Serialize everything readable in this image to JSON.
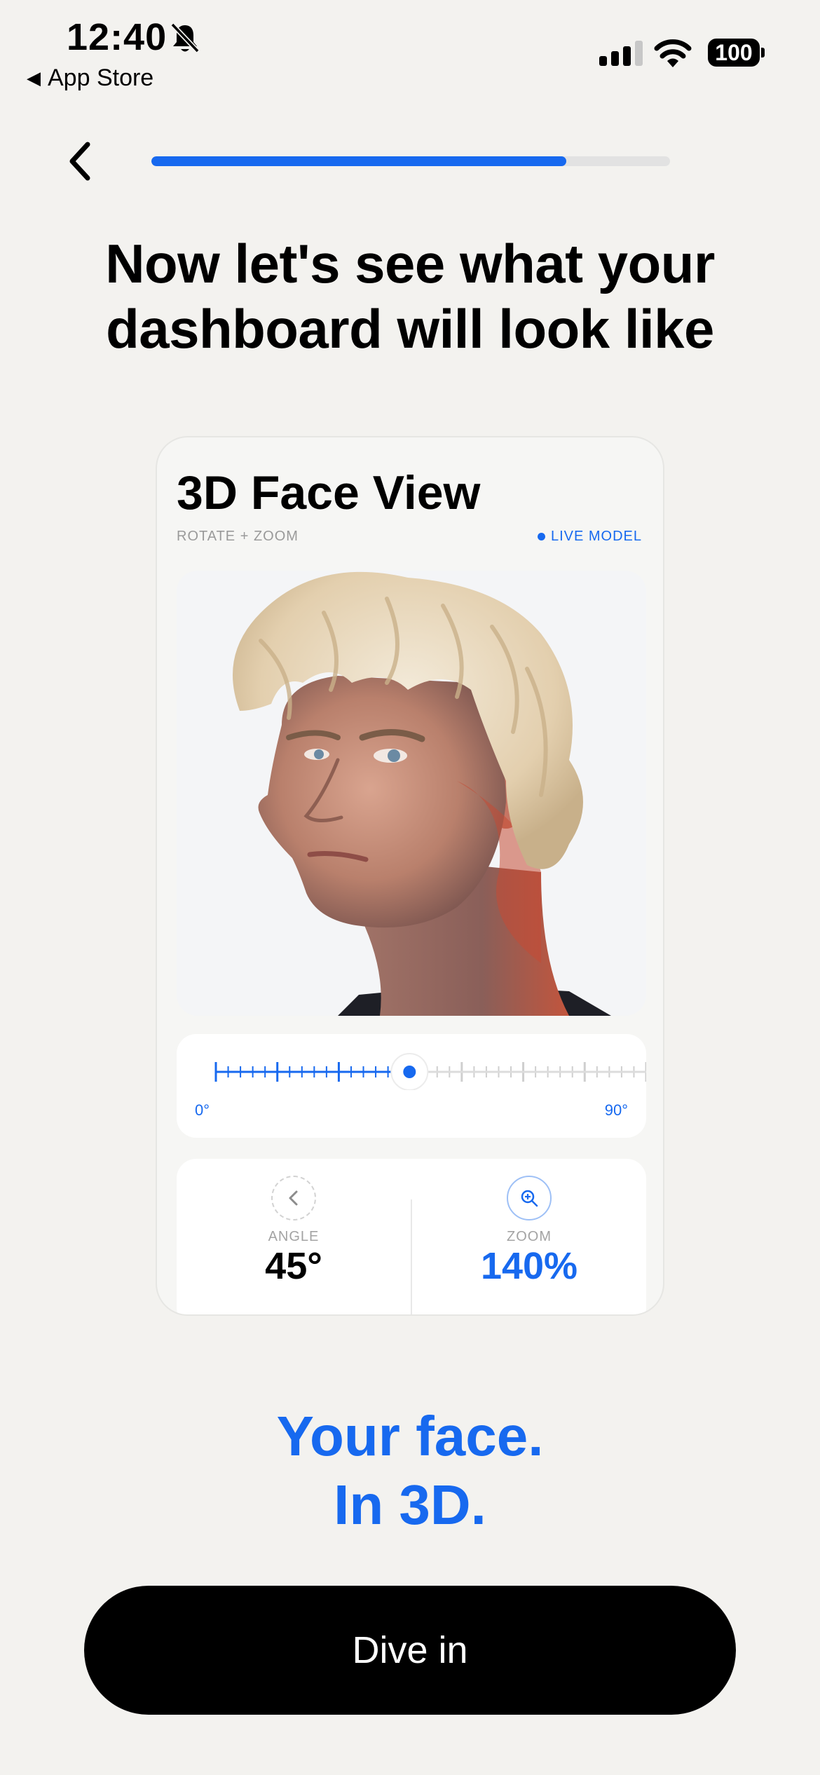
{
  "status_bar": {
    "time": "12:40",
    "back_app": "App Store",
    "battery": "100"
  },
  "onboarding": {
    "progress_fraction": 0.8
  },
  "headline": {
    "line1": "Now let's see what your",
    "line2": "dashboard will look like"
  },
  "card": {
    "title": "3D Face View",
    "subtitle": "ROTATE + ZOOM",
    "live_label": "LIVE MODEL",
    "slider": {
      "min_label": "0°",
      "max_label": "90°",
      "value_fraction": 0.45
    },
    "stats": [
      {
        "label": "ANGLE",
        "value": "45°",
        "icon": "chevron-left-icon"
      },
      {
        "label": "ZOOM",
        "value": "140%",
        "icon": "zoom-in-icon"
      }
    ]
  },
  "tagline": {
    "line1": "Your face.",
    "line2": "In 3D."
  },
  "cta": {
    "label": "Dive in"
  },
  "colors": {
    "accent": "#1769ef",
    "background": "#f3f2ef",
    "button": "#000000"
  }
}
